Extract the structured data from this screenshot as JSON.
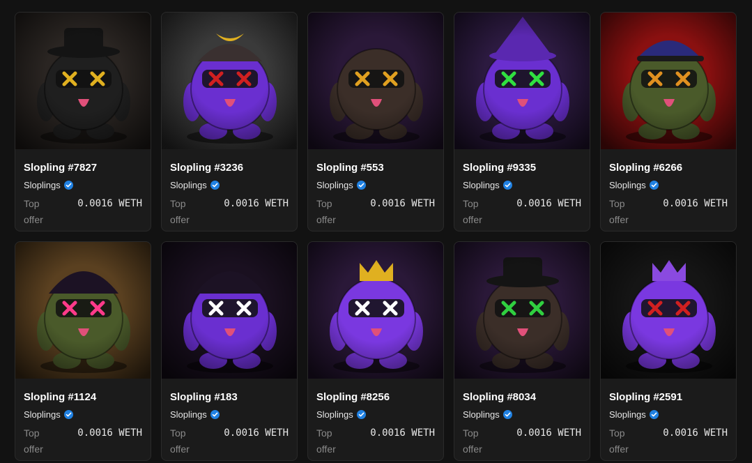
{
  "colors": {
    "background": "#121212",
    "card": "#1b1b1b",
    "verified": "#2081e2"
  },
  "offer_label": "Top offer",
  "cards": [
    {
      "name": "Slopling #7827",
      "collection": "Sloplings",
      "price": "0.0016 WETH",
      "bg": "#2a2522",
      "body": "#1f1f1f",
      "eyes": "#e0b020",
      "hat": "cowboy-hat"
    },
    {
      "name": "Slopling #3236",
      "collection": "Sloplings",
      "price": "0.0016 WETH",
      "bg": "#3a3a3a",
      "body": "#6a2fd0",
      "eyes": "#d02020",
      "hat": "samurai-helmet"
    },
    {
      "name": "Slopling #553",
      "collection": "Sloplings",
      "price": "0.0016 WETH",
      "bg": "#2a1838",
      "body": "#3b2e28",
      "eyes": "#e0a020",
      "hat": "none"
    },
    {
      "name": "Slopling #9335",
      "collection": "Sloplings",
      "price": "0.0016 WETH",
      "bg": "#2c1a40",
      "body": "#6a2fd0",
      "eyes": "#30e040",
      "hat": "wizard-hat"
    },
    {
      "name": "Slopling #6266",
      "collection": "Sloplings",
      "price": "0.0016 WETH",
      "bg": "#8a1010",
      "body": "#4a5a2a",
      "eyes": "#e09020",
      "hat": "cap"
    },
    {
      "name": "Slopling #1124",
      "collection": "Sloplings",
      "price": "0.0016 WETH",
      "bg": "#5a4020",
      "body": "#4a5a2a",
      "eyes": "#ff3a8a",
      "hat": "bucket-hat"
    },
    {
      "name": "Slopling #183",
      "collection": "Sloplings",
      "price": "0.0016 WETH",
      "bg": "#1a1020",
      "body": "#6a2fd0",
      "eyes": "#ffffff",
      "hat": "hood"
    },
    {
      "name": "Slopling #8256",
      "collection": "Sloplings",
      "price": "0.0016 WETH",
      "bg": "#2a1838",
      "body": "#7a38e0",
      "eyes": "#ffffff",
      "hat": "crown"
    },
    {
      "name": "Slopling #8034",
      "collection": "Sloplings",
      "price": "0.0016 WETH",
      "bg": "#2a1838",
      "body": "#3b2e28",
      "eyes": "#30d040",
      "hat": "top-hat"
    },
    {
      "name": "Slopling #2591",
      "collection": "Sloplings",
      "price": "0.0016 WETH",
      "bg": "#151515",
      "body": "#7a38e0",
      "eyes": "#d02020",
      "hat": "crown"
    }
  ]
}
